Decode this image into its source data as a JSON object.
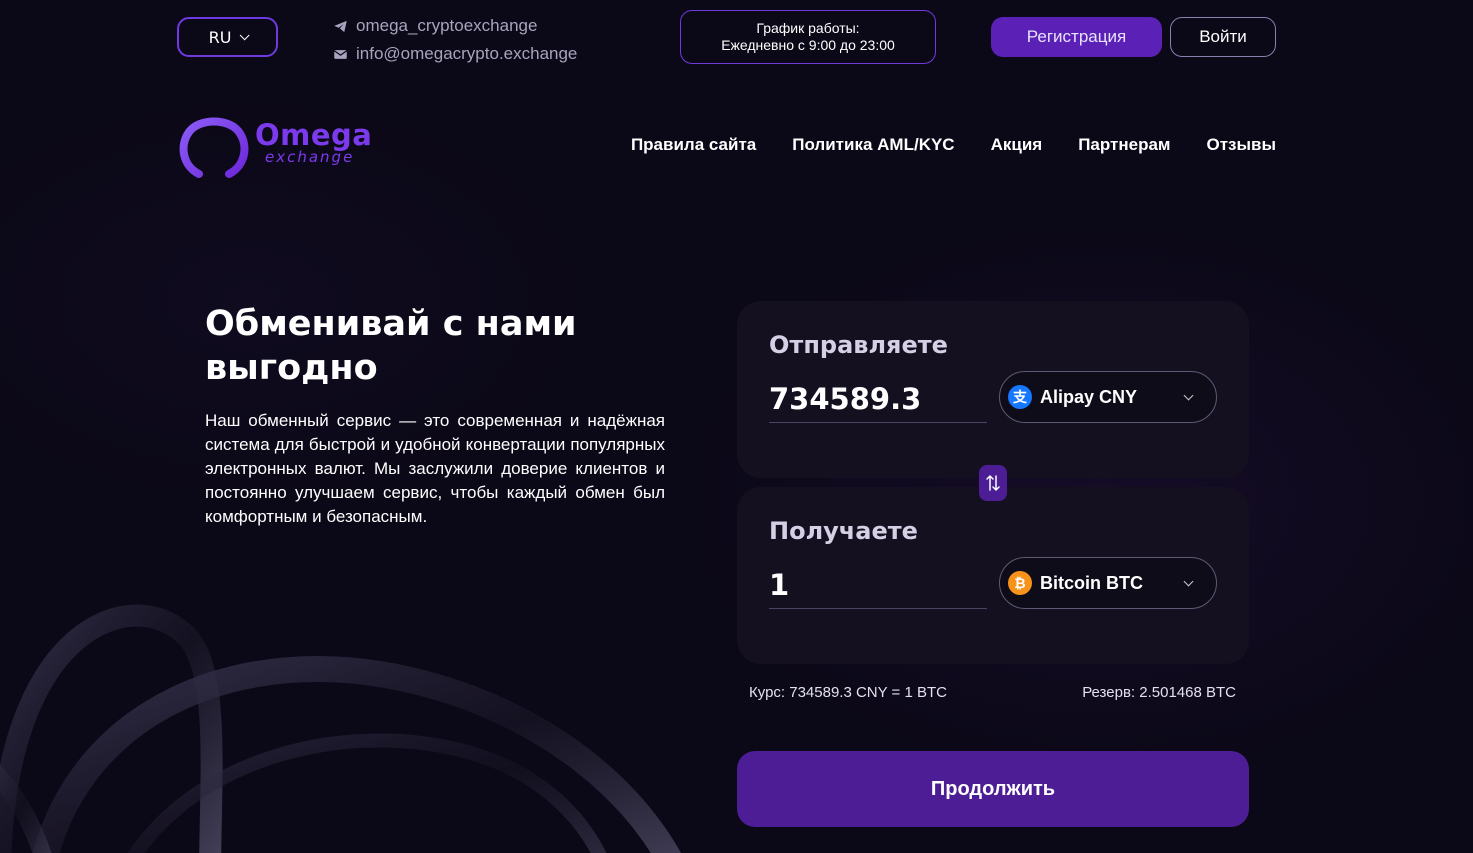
{
  "header": {
    "language": "RU",
    "telegram": "omega_cryptoexchange",
    "email": "info@omegacrypto.exchange",
    "schedule_title": "График работы:",
    "schedule_hours": "Ежедневно с 9:00 до 23:00",
    "register_label": "Регистрация",
    "login_label": "Войти"
  },
  "logo": {
    "name": "Omega",
    "sub": "exchange"
  },
  "nav": {
    "items": [
      "Правила сайта",
      "Политика AML/KYC",
      "Акция",
      "Партнерам",
      "Отзывы"
    ]
  },
  "hero": {
    "title": "Обменивай с нами выгодно",
    "text": "Наш обменный сервис — это современная и надёжная система для быстрой и удобной конвертации популярных электронных валют. Мы заслужили доверие клиентов и постоянно улучшаем сервис, чтобы каждый обмен был комфортным и безопасным."
  },
  "exchange": {
    "send_label": "Отправляете",
    "send_amount": "734589.3",
    "send_currency": "Alipay CNY",
    "receive_label": "Получаете",
    "receive_amount": "1",
    "receive_currency": "Bitcoin BTC",
    "rate": "Курс: 734589.3 CNY = 1 BTC",
    "reserve": "Резерв: 2.501468 BTC",
    "continue_label": "Продолжить"
  },
  "icons": {
    "telegram": "telegram-icon",
    "email": "mail-icon",
    "alipay": "alipay-icon",
    "bitcoin": "bitcoin-icon",
    "swap": "swap-arrows-icon"
  },
  "colors": {
    "background": "#0b0817",
    "accent": "#5b21b6",
    "border_accent": "#6d3be0",
    "card": "#14101f",
    "bitcoin": "#f7931a",
    "alipay": "#1677ff"
  }
}
